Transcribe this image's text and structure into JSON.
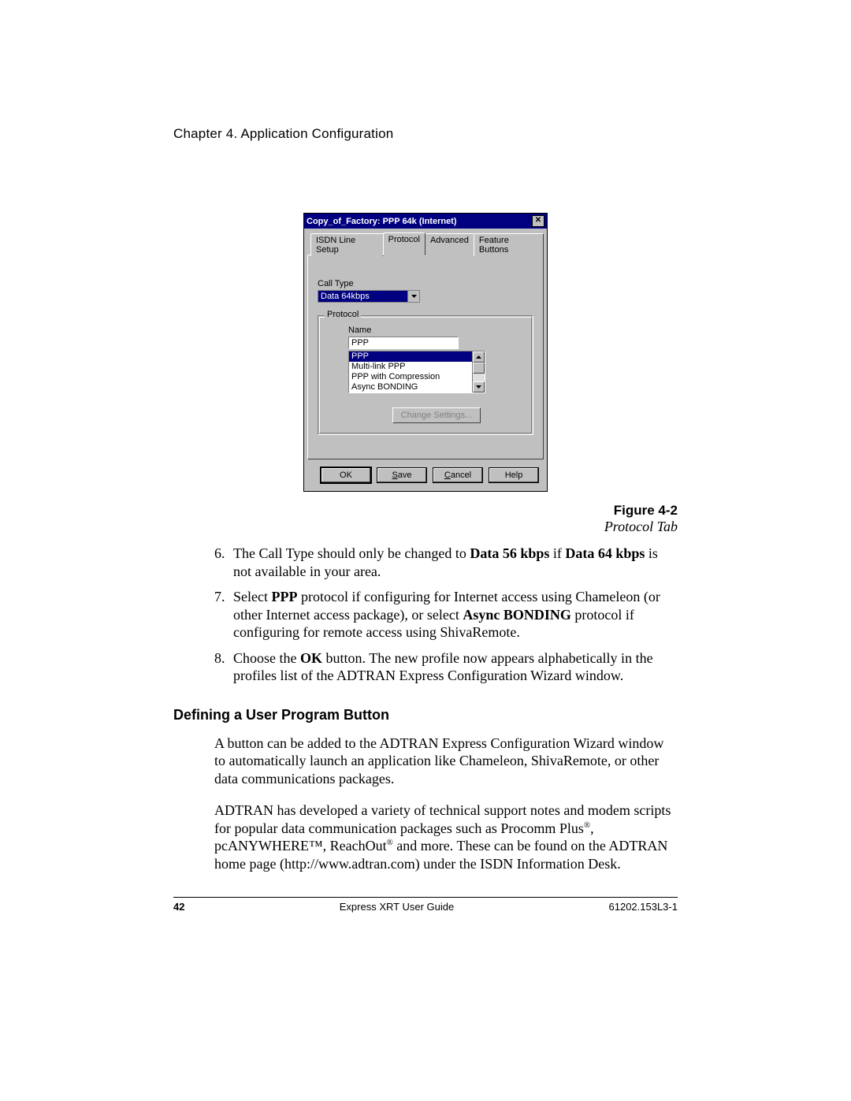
{
  "header": "Chapter 4. Application Configuration",
  "dialog": {
    "title": "Copy_of_Factory: PPP 64k (Internet)",
    "close_glyph": "✕",
    "tabs": [
      "ISDN Line Setup",
      "Protocol",
      "Advanced",
      "Feature Buttons"
    ],
    "active_tab_index": 1,
    "call_type_label": "Call Type",
    "call_type_value": "Data 64kbps",
    "protocol_legend": "Protocol",
    "name_label": "Name",
    "name_value": "PPP",
    "protocol_options": [
      "PPP",
      "Multi-link PPP",
      "PPP with Compression",
      "Async BONDING"
    ],
    "selected_protocol_index": 0,
    "change_settings_label": "Change Settings...",
    "buttons": {
      "ok": "OK",
      "save": "Save",
      "cancel": "Cancel",
      "help": "Help"
    }
  },
  "figure": {
    "number": "Figure 4-2",
    "title": "Protocol Tab"
  },
  "steps": {
    "s6_num": "6.",
    "s6_a": "The Call Type should only be changed to ",
    "s6_b1": "Data 56 kbps",
    "s6_c": " if ",
    "s6_b2": "Data 64 kbps",
    "s6_d": " is not available in your area.",
    "s7_num": "7.",
    "s7_a": "Select ",
    "s7_b1": "PPP",
    "s7_c": " protocol if configuring for Internet access using Chameleon (or other Internet access package), or select ",
    "s7_b2": "Async BONDING",
    "s7_d": " protocol if configuring for remote access using ShivaRemote.",
    "s8_num": "8.",
    "s8_a": "Choose the ",
    "s8_b1": "OK",
    "s8_c": " button.  The new profile now appears alphabetically in the profiles list of the ADTRAN Express Configuration Wizard window."
  },
  "section_heading": "Defining a User Program Button",
  "para1": "A button can be added to the ADTRAN Express Configuration Wizard window to automatically launch an application like Chameleon, ShivaRemote, or other data communications packages.",
  "para2_a": "ADTRAN has developed a variety of technical support notes and modem scripts for popular data communication packages such as Procomm Plus",
  "para2_b": ", pcANYWHERE™, ReachOut",
  "para2_c": " and more.  These can be found on the ADTRAN home page (http://www.adtran.com) under the ISDN Information Desk.",
  "reg_mark": "®",
  "footer": {
    "page": "42",
    "center": "Express XRT User Guide",
    "right": "61202.153L3-1"
  }
}
